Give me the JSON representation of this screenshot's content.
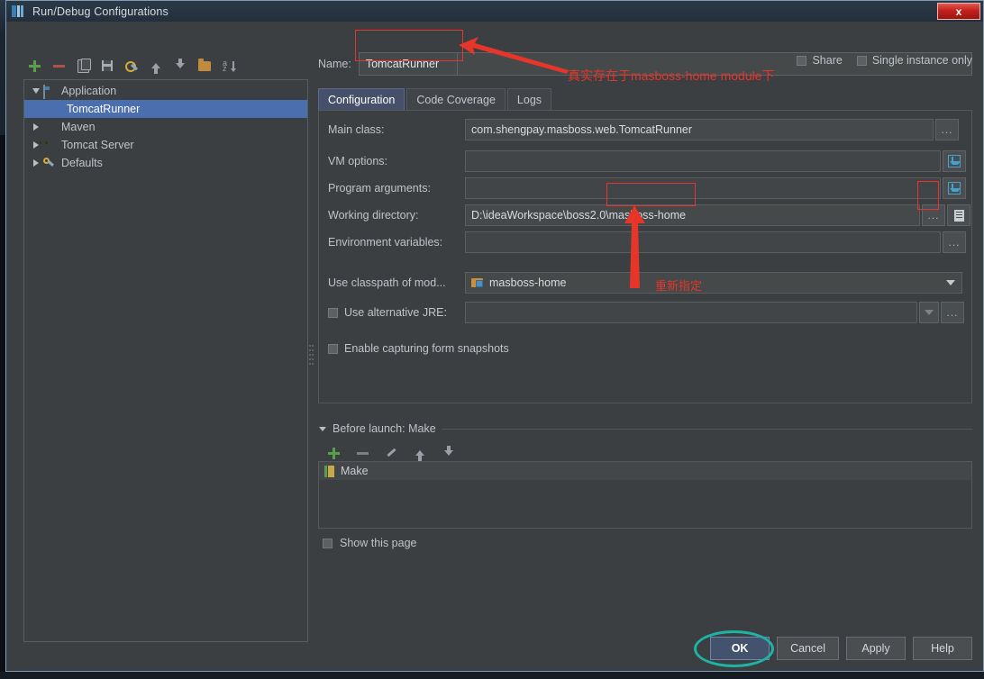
{
  "window": {
    "title": "Run/Debug Configurations",
    "app_icon": "intellij-idea-icon",
    "close_label": "x"
  },
  "toolbar": {
    "buttons": [
      {
        "name": "add",
        "icon": "plus-icon"
      },
      {
        "name": "remove",
        "icon": "minus-icon"
      },
      {
        "name": "copy",
        "icon": "copy-icon"
      },
      {
        "name": "save",
        "icon": "save-icon"
      },
      {
        "name": "edit-defaults",
        "icon": "wrench-icon"
      },
      {
        "name": "move-up",
        "icon": "arrow-up-icon"
      },
      {
        "name": "move-down",
        "icon": "arrow-down-icon"
      },
      {
        "name": "folder",
        "icon": "folder-icon"
      },
      {
        "name": "sort",
        "icon": "sort-alpha-icon"
      }
    ]
  },
  "tree": {
    "items": [
      {
        "label": "Application",
        "icon": "application-icon",
        "expanded": true,
        "level": 0,
        "selected": false
      },
      {
        "label": "TomcatRunner",
        "icon": "run-config-icon",
        "expanded": null,
        "level": 1,
        "selected": true
      },
      {
        "label": "Maven",
        "icon": "maven-icon",
        "expanded": false,
        "level": 0,
        "selected": false
      },
      {
        "label": "Tomcat Server",
        "icon": "tomcat-icon",
        "expanded": false,
        "level": 0,
        "selected": false
      },
      {
        "label": "Defaults",
        "icon": "defaults-icon",
        "expanded": false,
        "level": 0,
        "selected": false
      }
    ]
  },
  "header": {
    "name_label": "Name:",
    "name_value": "TomcatRunner",
    "share_label": "Share",
    "share_checked": false,
    "single_instance_label": "Single instance only",
    "single_instance_checked": false
  },
  "tabs": [
    {
      "label": "Configuration",
      "active": true
    },
    {
      "label": "Code Coverage",
      "active": false
    },
    {
      "label": "Logs",
      "active": false
    }
  ],
  "form": {
    "main_class": {
      "label": "Main class:",
      "value": "com.shengpay.masboss.web.TomcatRunner",
      "browse": "..."
    },
    "vm_options": {
      "label": "VM options:",
      "value": "",
      "expand_icon": "expand-editor-icon"
    },
    "program_arguments": {
      "label": "Program arguments:",
      "value": "",
      "expand_icon": "expand-editor-icon"
    },
    "working_directory": {
      "label": "Working directory:",
      "value_prefix": "D:\\ideaWorkspace\\boss2.0\\",
      "value_highlight": "masboss-home",
      "browse": "...",
      "macro_icon": "insert-macro-icon"
    },
    "environment_variables": {
      "label": "Environment variables:",
      "value": "",
      "browse": "..."
    },
    "use_classpath": {
      "label": "Use classpath of mod...",
      "value": "masboss-home",
      "icon": "module-icon"
    },
    "alternative_jre": {
      "label": "Use alternative JRE:",
      "checked": false,
      "value": "",
      "browse": "..."
    },
    "form_snapshots": {
      "label": "Enable capturing form snapshots",
      "checked": false
    }
  },
  "before_launch": {
    "title": "Before launch: Make",
    "toolbar": [
      {
        "name": "add-task",
        "icon": "plus-icon"
      },
      {
        "name": "remove-task",
        "icon": "minus-icon"
      },
      {
        "name": "edit-task",
        "icon": "pencil-icon"
      },
      {
        "name": "move-task-up",
        "icon": "arrow-up-icon"
      },
      {
        "name": "move-task-down",
        "icon": "arrow-down-icon"
      }
    ],
    "items": [
      {
        "label": "Make",
        "icon": "make-icon"
      }
    ],
    "show_this_page": {
      "label": "Show this page",
      "checked": false
    }
  },
  "footer": {
    "buttons": [
      {
        "label": "OK",
        "primary": true
      },
      {
        "label": "Cancel",
        "primary": false
      },
      {
        "label": "Apply",
        "primary": false
      },
      {
        "label": "Help",
        "primary": false
      }
    ]
  },
  "annotations": {
    "note_module": "真实存在于masboss-home module下",
    "note_respecify": "重新指定",
    "colors": {
      "red": "#e8352a",
      "teal": "#1fb3a6",
      "accent_blue": "#4b6eaf"
    }
  }
}
